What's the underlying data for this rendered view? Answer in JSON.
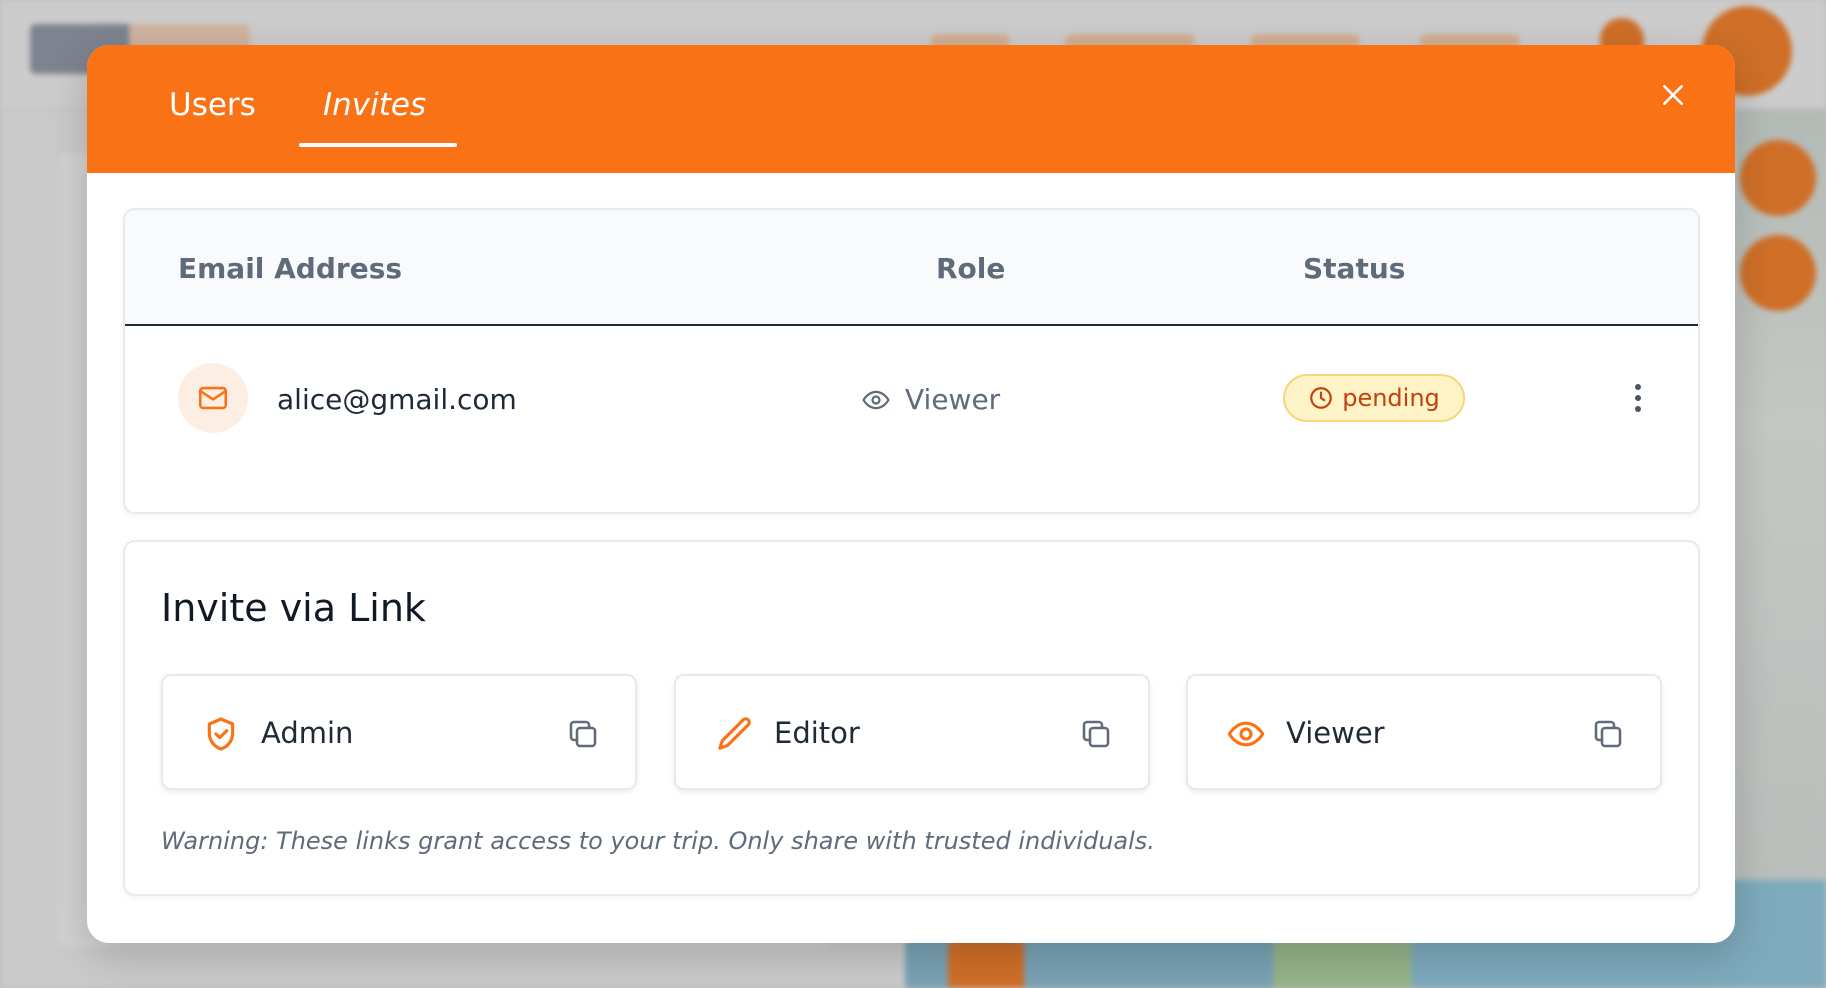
{
  "modal": {
    "tabs": [
      {
        "label": "Users",
        "active": false
      },
      {
        "label": "Invites",
        "active": true
      }
    ],
    "close_icon": "close-icon"
  },
  "invites_table": {
    "headers": {
      "email": "Email Address",
      "role": "Role",
      "status": "Status"
    },
    "rows": [
      {
        "email": "alice@gmail.com",
        "role": "Viewer",
        "status": "pending"
      }
    ]
  },
  "invite_link": {
    "title": "Invite via Link",
    "links": [
      {
        "role": "Admin",
        "icon": "shield-check-icon"
      },
      {
        "role": "Editor",
        "icon": "pencil-icon"
      },
      {
        "role": "Viewer",
        "icon": "eye-icon"
      }
    ],
    "warning": "Warning: These links grant access to your trip. Only share with trusted individuals."
  },
  "colors": {
    "accent": "#f97316",
    "badge_bg": "#fef3c7",
    "badge_text": "#c2410c",
    "muted_text": "#5f6b7a"
  }
}
